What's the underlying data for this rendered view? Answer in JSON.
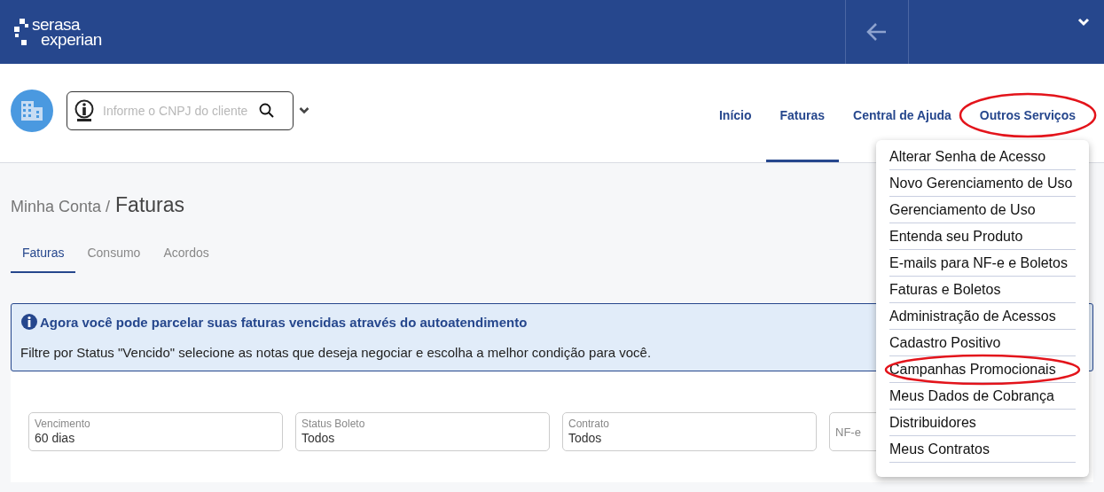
{
  "header": {
    "logo": [
      "serasa",
      "experian"
    ]
  },
  "search": {
    "placeholder": "Informe o CNPJ do cliente"
  },
  "nav": [
    {
      "label": "Início",
      "selected": false,
      "circled": false
    },
    {
      "label": "Faturas",
      "selected": true,
      "circled": false
    },
    {
      "label": "Central de Ajuda",
      "selected": false,
      "circled": false
    },
    {
      "label": "Outros Serviços",
      "selected": false,
      "circled": true
    }
  ],
  "breadcrumb": {
    "parent": "Minha Conta /",
    "current": "Faturas"
  },
  "tabs": [
    {
      "label": "Faturas",
      "selected": true
    },
    {
      "label": "Consumo",
      "selected": false
    },
    {
      "label": "Acordos",
      "selected": false
    }
  ],
  "alert": {
    "title": "Agora você pode parcelar suas faturas vencidas através do autoatendimento",
    "text": "Filtre por Status \"Vencido\" selecione as notas que deseja negociar e escolha a melhor condição para você."
  },
  "filters": [
    {
      "label": "Vencimento",
      "value": "60 dias"
    },
    {
      "label": "Status Boleto",
      "value": "Todos"
    },
    {
      "label": "Contrato",
      "value": "Todos"
    },
    {
      "label": "NF-e"
    }
  ],
  "menu": [
    {
      "label": "Alterar Senha de Acesso",
      "circled": false
    },
    {
      "label": "Novo Gerenciamento de Uso",
      "circled": false
    },
    {
      "label": "Gerenciamento de Uso",
      "circled": false
    },
    {
      "label": "Entenda seu Produto",
      "circled": false
    },
    {
      "label": "E-mails para NF-e e Boletos",
      "circled": false
    },
    {
      "label": "Faturas e Boletos",
      "circled": false
    },
    {
      "label": "Administração de Acessos",
      "circled": false
    },
    {
      "label": "Cadastro Positivo",
      "circled": false
    },
    {
      "label": "Campanhas Promocionais",
      "circled": true
    },
    {
      "label": "Meus Dados de Cobrança",
      "circled": false
    },
    {
      "label": "Distribuidores",
      "circled": false
    },
    {
      "label": "Meus Contratos",
      "circled": false
    }
  ]
}
